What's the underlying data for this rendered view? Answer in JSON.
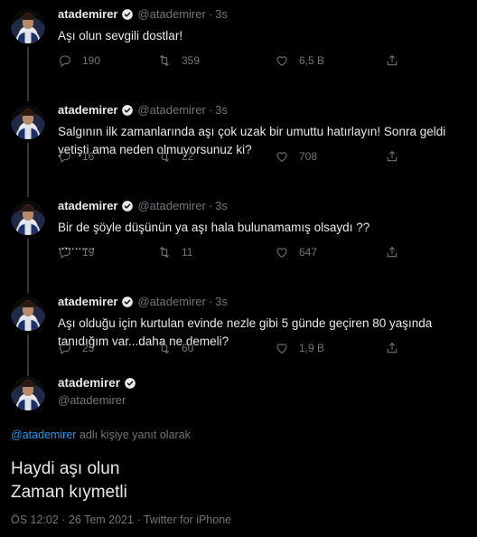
{
  "user": {
    "name": "atademirer",
    "handle": "@atademirer"
  },
  "tweets": [
    {
      "time": "3s",
      "text": "Aşı olun sevgili dostlar!",
      "text2": "",
      "replies": "190",
      "retweets": "359",
      "likes": "6,5 B"
    },
    {
      "time": "3s",
      "text": "Salgının ilk zamanlarında aşı çok uzak bir umuttu hatırlayın! Sonra geldi",
      "text2": "yetişti ama neden olmuyorsunuz ki?",
      "replies": "16",
      "retweets": "22",
      "likes": "708"
    },
    {
      "time": "3s",
      "text": "Bir de şöyle düşünün ya aşı hala bulunamamış olsaydı ??",
      "text2": "...........",
      "replies": "19",
      "retweets": "11",
      "likes": "647"
    },
    {
      "time": "3s",
      "text": "Aşı olduğu için kurtulan evinde nezle gibi 5 günde geçiren 80 yaşında",
      "text2": "tanıdığım var...daha ne demeli?",
      "replies": "23",
      "retweets": "60",
      "likes": "1,9 B"
    }
  ],
  "main": {
    "reply_mention": "@atademirer",
    "reply_suffix": " adlı kişiye yanıt olarak",
    "line1": "Haydi aşı olun",
    "line2": "Zaman kıymetli",
    "meta": "ÖS 12:02 · 26 Tem 2021 · Twitter for iPhone"
  },
  "icons": [
    "verified-badge-icon",
    "reply-icon",
    "retweet-icon",
    "like-icon",
    "share-icon"
  ],
  "colors": {
    "background": "#000000",
    "text": "#e7e9ea",
    "secondary": "#71767b",
    "accent": "#1d9bf0"
  }
}
